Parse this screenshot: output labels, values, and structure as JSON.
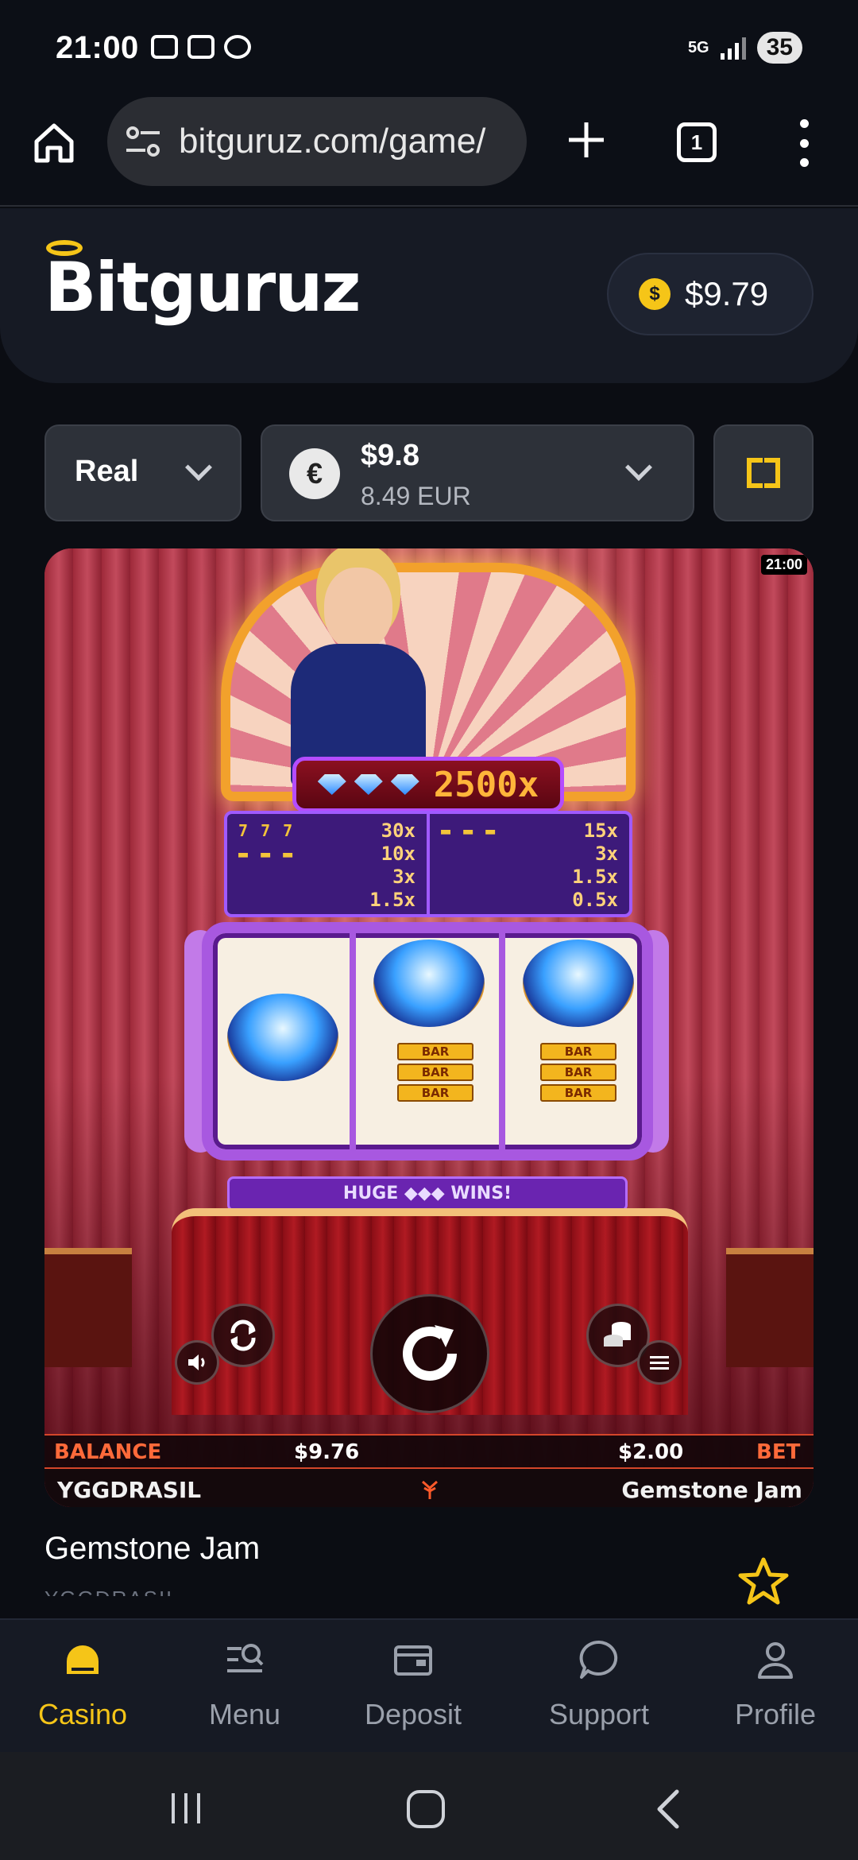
{
  "status_bar": {
    "time": "21:00",
    "network": "5G",
    "battery": "35"
  },
  "browser": {
    "url": "bitguruz.com/game/",
    "tab_count": "1"
  },
  "site": {
    "logo": "Bitguruz",
    "balance": "$9.79"
  },
  "controls": {
    "mode": "Real",
    "currency_symbol": "€",
    "amount": "$9.8",
    "converted": "8.49 EUR"
  },
  "game": {
    "clock": "21:00",
    "jackpot": "2500x",
    "paytable_left": [
      {
        "symbol": "7 7 7",
        "mult": "30x"
      },
      {
        "symbol": "▬ ▬ ▬",
        "mult": "10x"
      },
      {
        "symbol": "",
        "mult": "3x"
      },
      {
        "symbol": "",
        "mult": "1.5x"
      }
    ],
    "paytable_right": [
      {
        "symbol": "▬ ▬ ▬",
        "mult": "15x"
      },
      {
        "symbol": "",
        "mult": "3x"
      },
      {
        "symbol": "",
        "mult": "1.5x"
      },
      {
        "symbol": "",
        "mult": "0.5x"
      }
    ],
    "bar_symbol": "BAR",
    "banner": "HUGE ◆◆◆ WINS!",
    "balance_label": "BALANCE",
    "balance_value": "$9.76",
    "bet_value": "$2.00",
    "bet_label": "BET",
    "provider": "YGGDRASIL",
    "game_name": "Gemstone Jam"
  },
  "details": {
    "title": "Gemstone Jam",
    "provider": "YGGDRASIL"
  },
  "nav": {
    "casino": "Casino",
    "menu": "Menu",
    "deposit": "Deposit",
    "support": "Support",
    "profile": "Profile"
  },
  "colors": {
    "accent": "#f5c518",
    "background": "#0b0d13",
    "card": "#2d3139"
  }
}
